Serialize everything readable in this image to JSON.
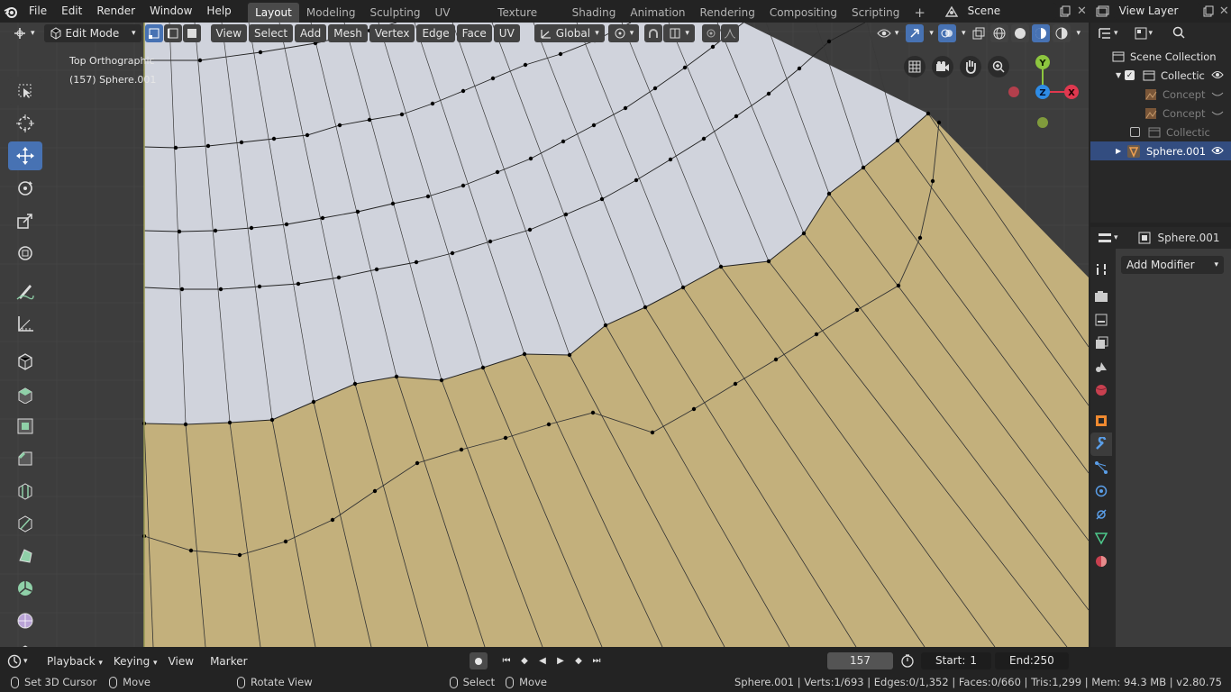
{
  "menu": {
    "items": [
      "File",
      "Edit",
      "Render",
      "Window",
      "Help"
    ]
  },
  "workspaces": {
    "tabs": [
      "Layout",
      "Modeling",
      "Sculpting",
      "UV Editing",
      "Texture Paint",
      "Shading",
      "Animation",
      "Rendering",
      "Compositing",
      "Scripting"
    ],
    "active": "Layout",
    "add_label": "+"
  },
  "scene": {
    "label": "Scene"
  },
  "view_layer": {
    "label": "View Layer"
  },
  "viewport_header": {
    "mode": "Edit Mode",
    "menus": [
      "View",
      "Select",
      "Add",
      "Mesh",
      "Vertex",
      "Edge",
      "Face",
      "UV"
    ],
    "transform_orientation": "Global"
  },
  "viewport": {
    "view_name": "Top Orthographic",
    "object_info": "(157) Sphere.001",
    "gizmo": {
      "x": "X",
      "y": "Y",
      "z": "Z"
    }
  },
  "toolbar": {
    "tools": [
      "select-box",
      "cursor",
      "move",
      "rotate",
      "scale",
      "transform",
      "annotate",
      "measure",
      "add-cube",
      "extrude",
      "inset",
      "bevel",
      "loop-cut",
      "knife",
      "poly-build",
      "spin",
      "smooth",
      "shrink"
    ]
  },
  "outliner": {
    "title": "Scene Collection",
    "rows": [
      {
        "label": "Collectic",
        "dim": false,
        "selected": false
      },
      {
        "label": "Concept",
        "dim": true,
        "selected": false
      },
      {
        "label": "Concept",
        "dim": true,
        "selected": false
      },
      {
        "label": "Collectic",
        "dim": true,
        "selected": false
      },
      {
        "label": "Sphere.001",
        "dim": false,
        "selected": true
      }
    ]
  },
  "properties": {
    "object_name": "Sphere.001",
    "add_modifier_label": "Add Modifier"
  },
  "timeline": {
    "menus": [
      "Playback",
      "Keying",
      "View",
      "Marker"
    ],
    "current_frame": "157",
    "start_label": "Start:",
    "start": "1",
    "end_label": "End:",
    "end": "250"
  },
  "statusbar": {
    "left": [
      {
        "label": "Set 3D Cursor"
      },
      {
        "label": "Move"
      },
      {
        "label": "Rotate View"
      },
      {
        "label": "Select"
      },
      {
        "label": "Move"
      }
    ],
    "stats": "Sphere.001 | Verts:1/693 | Edges:0/1,352 | Faces:0/660 | Tris:1,299 | Mem: 94.3 MB | v2.80.75"
  },
  "colors": {
    "mesh_white": "#d0d3dc",
    "mesh_tan": "#c3b07c",
    "background": "#3d3d3d",
    "accent": "#4772b3",
    "axis_x": "#e0384f",
    "axis_y": "#8dc63f",
    "axis_z": "#2e8ce6"
  }
}
